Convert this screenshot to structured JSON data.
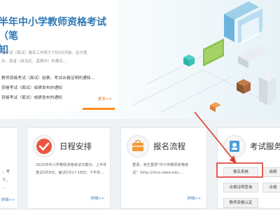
{
  "banner": {
    "headline": "半年中小学教师资格考试（笔\n知",
    "summary": "格考试（笔试）报名工作将于7月4日开始，此次笔\n办，各省（自治区、直辖市）的报名...",
    "news": [
      "教师资格考试（面试）结果、考试合格证明的通知...",
      "资格考试（面试）成绩发布的通知",
      "资格考试（笔试）成绩发布的通知"
    ],
    "more": "更多>>"
  },
  "schedule": {
    "title": "日程安排",
    "text": "2025年中小学教师资格考试日期为：上半年笔试3月8日，面试5月17-18日；下半年...",
    "more": "详细>>"
  },
  "process": {
    "title": "报名流程",
    "text": "登录。考生登录\"中小学教师资格考试\"（http://ntce.neea.edu....",
    "more": "详细>>"
  },
  "services": {
    "title": "考试服务",
    "buttons": [
      "报名系统",
      "成绩",
      "合格证明查询",
      "合格",
      "教师资格认定"
    ]
  },
  "left_card": {
    "lines": [
      "，考",
      "下，",
      "..."
    ],
    "more": "详细>>"
  },
  "colors": {
    "accent_orange": "#ff8a1f",
    "headline_blue": "#2f79b7",
    "highlight_red": "#e03a2e",
    "icon_blue": "#4a9fd8",
    "icon_orange": "#f29a38"
  }
}
